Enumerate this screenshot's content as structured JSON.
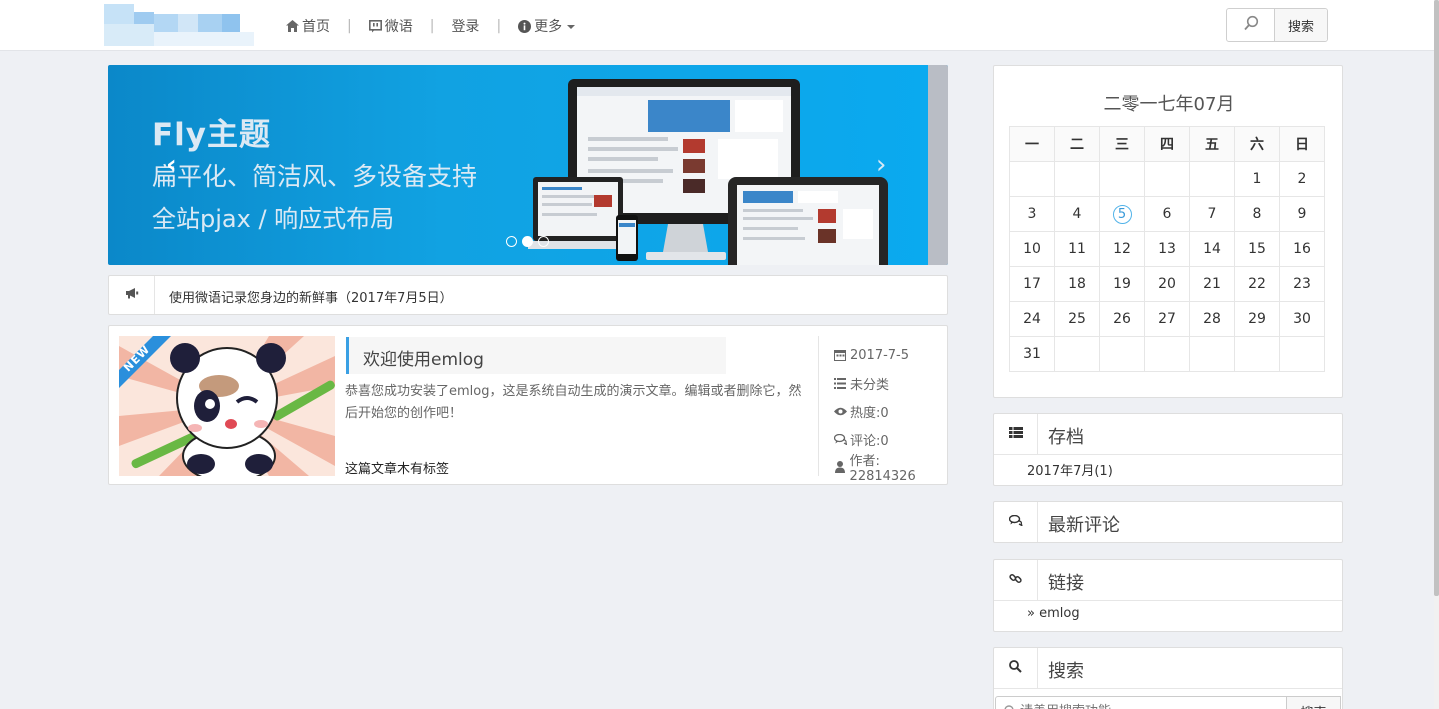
{
  "nav": {
    "items": [
      {
        "label": "首页",
        "icon": "home-icon"
      },
      {
        "label": "微语",
        "icon": "chat-bubble-icon"
      },
      {
        "label": "登录"
      },
      {
        "label": "更多",
        "icon": "info-icon"
      }
    ],
    "search_button": "搜索"
  },
  "banner": {
    "title": "Fly主题",
    "line1": "扁平化、简洁风、多设备支持",
    "line2": "全站pjax / 响应式布局",
    "prev": "‹",
    "next": "›"
  },
  "notice": {
    "text": "使用微语记录您身边的新鲜事（2017年7月5日）"
  },
  "post": {
    "badge": "NEW",
    "title": "欢迎使用emlog",
    "excerpt": "恭喜您成功安装了emlog，这是系统自动生成的演示文章。编辑或者删除它，然后开始您的创作吧！",
    "tags": "这篇文章木有标签",
    "meta": {
      "date": "2017-7-5",
      "category": "未分类",
      "views": "热度:0",
      "comments": "评论:0",
      "author": "作者: 22814326"
    }
  },
  "calendar": {
    "title": "二零一七年07月",
    "weekdays": [
      "一",
      "二",
      "三",
      "四",
      "五",
      "六",
      "日"
    ],
    "weeks": [
      [
        "",
        "",
        "",
        "",
        "",
        "1",
        "2"
      ],
      [
        "3",
        "4",
        "5",
        "6",
        "7",
        "8",
        "9"
      ],
      [
        "10",
        "11",
        "12",
        "13",
        "14",
        "15",
        "16"
      ],
      [
        "17",
        "18",
        "19",
        "20",
        "21",
        "22",
        "23"
      ],
      [
        "24",
        "25",
        "26",
        "27",
        "28",
        "29",
        "30"
      ],
      [
        "31",
        "",
        "",
        "",
        "",
        "",
        ""
      ]
    ],
    "today": "5"
  },
  "widgets": {
    "archive": {
      "title": "存档",
      "item": "2017年7月(1)"
    },
    "comments": {
      "title": "最新评论"
    },
    "links": {
      "title": "链接",
      "item": "» emlog"
    },
    "search": {
      "title": "搜索",
      "placeholder": "请善用搜索功能",
      "button": "搜索"
    }
  }
}
